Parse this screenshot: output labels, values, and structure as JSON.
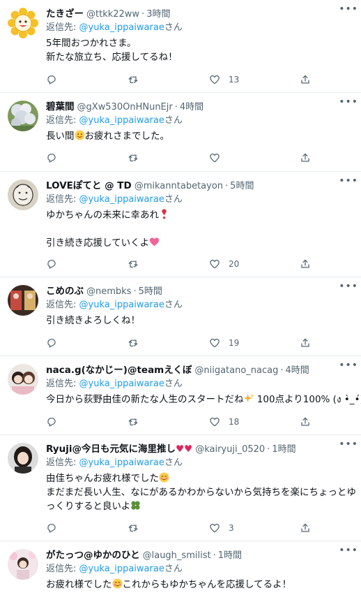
{
  "tweets": [
    {
      "name": "たきざー",
      "handle": "@ttkk22ww",
      "time": "3時間",
      "reply_prefix": "返信先: ",
      "reply_mention": "@yuka_ippaiwarae",
      "reply_suffix": "さん",
      "text": "5年間おつかれさま。\n新たな旅立ち、応援してるね！",
      "likes": "13",
      "avatar": "sunflower-avatar"
    },
    {
      "name": "碧葉間",
      "handle": "@gXw530OnHNunEjr",
      "time": "4時間",
      "reply_prefix": "返信先: ",
      "reply_mention": "@yuka_ippaiwarae",
      "reply_suffix": "さん",
      "text_a": "長い間",
      "text_b": "お疲れさまでした。",
      "emoji": "smiling-face",
      "likes": "",
      "avatar": "flower-photo-avatar"
    },
    {
      "name": "LOVEぽてと @ TD",
      "handle": "@mikanntabetayon",
      "time": "5時間",
      "reply_prefix": "返信先: ",
      "reply_mention": "@yuka_ippaiwarae",
      "reply_suffix": "さん",
      "text_a": "ゆかちゃんの未来に幸あれ",
      "text_a_emoji": "exclamation-heart",
      "text_b": "引き続き応援していくよ",
      "text_b_emoji": "sparkling-heart",
      "likes": "20",
      "avatar": "doodle-face-avatar"
    },
    {
      "name": "こめのぶ",
      "handle": "@nembks",
      "time": "5時間",
      "reply_prefix": "返信先: ",
      "reply_mention": "@yuka_ippaiwarae",
      "reply_suffix": "さん",
      "text": "引き続きよろしくね！",
      "likes": "19",
      "avatar": "photo-avatar"
    },
    {
      "name": "naca.g(なかじー)@teamえくぼ",
      "handle": "@niigatano_nacag",
      "time": "4時間",
      "reply_prefix": "返信先: ",
      "reply_mention": "@yuka_ippaiwarae",
      "reply_suffix": "さん",
      "text_a": "今日から荻野由佳の新たな人生のスタートだね",
      "text_a_emoji": "sparkles",
      "text_b": " 100点より100% (ง •̀_•́)ง",
      "likes": "18",
      "avatar": "two-people-avatar"
    },
    {
      "name_a": "Ryuji@今日も元気に海里推し",
      "name_emoji": "two-hearts",
      "handle": "@kairyuji_0520",
      "time": "1時間",
      "reply_prefix": "返信先: ",
      "reply_mention": "@yuka_ippaiwarae",
      "reply_suffix": "さん",
      "line1": "由佳ちゃんお疲れ様でした",
      "line1_emoji": "smiling-face-blush",
      "line2": "まだまだ長い人生、なにがあるかわからないから気持ちを楽にちょっとゆ",
      "line3": "っくりすると良いよ",
      "line3_emoji": "four-leaf-clover",
      "likes": "3",
      "avatar": "person-avatar"
    },
    {
      "name": "がたっつ@ゆかのひと",
      "handle": "@laugh_smilist",
      "time": "1時間",
      "reply_prefix": "返信先: ",
      "reply_mention": "@yuka_ippaiwarae",
      "reply_suffix": "さん",
      "text_a": "お疲れ様でした",
      "text_a_emoji": "smiling-face-blush",
      "text_b": "これからもゆかちゃんを応援してるよ！",
      "avatar": "blossom-person-avatar"
    }
  ],
  "more_label": "•••",
  "separator": "·",
  "icons": [
    "reply-icon",
    "retweet-icon",
    "like-icon",
    "share-icon",
    "more-icon"
  ],
  "colors": {
    "mention": "#1d9bf0",
    "secondary": "#536471",
    "heart": "#e0245e"
  }
}
